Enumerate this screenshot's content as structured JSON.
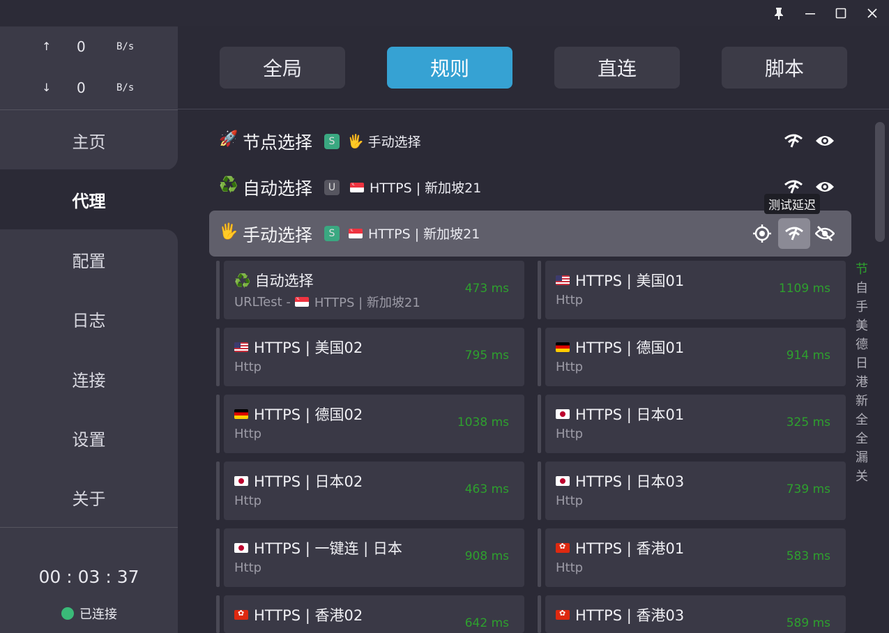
{
  "titlebar": {
    "icons": [
      "pin-icon",
      "minimize-icon",
      "maximize-icon",
      "close-icon"
    ]
  },
  "sidebar": {
    "upload": {
      "arrow": "↑",
      "value": "0",
      "unit": "B/s"
    },
    "download": {
      "arrow": "↓",
      "value": "0",
      "unit": "B/s"
    },
    "items": [
      {
        "label": "主页",
        "key": "home"
      },
      {
        "label": "代理",
        "key": "proxy"
      },
      {
        "label": "配置",
        "key": "profiles"
      },
      {
        "label": "日志",
        "key": "logs"
      },
      {
        "label": "连接",
        "key": "connections"
      },
      {
        "label": "设置",
        "key": "settings"
      },
      {
        "label": "关于",
        "key": "about"
      }
    ],
    "active_item": "代理",
    "timer": "00 : 03 : 37",
    "status": "已连接",
    "status_color": "#3aba78"
  },
  "modes": {
    "items": [
      "全局",
      "规则",
      "直连",
      "脚本"
    ],
    "active": "规则",
    "accent": "#36a2d3"
  },
  "groups": [
    {
      "emoji": "🚀",
      "name": "节点选择",
      "badge": "S",
      "current_emoji": "🖐",
      "current": "手动选择"
    },
    {
      "emoji": "♻️",
      "name": "自动选择",
      "badge": "U",
      "current_flag": "sg",
      "current": "HTTPS | 新加坡21"
    },
    {
      "emoji": "🖐",
      "name": "手动选择",
      "badge": "S",
      "current_flag": "sg",
      "current": "HTTPS | 新加坡21"
    }
  ],
  "tooltip": "测试延迟",
  "proxies": [
    {
      "name": "自动选择",
      "emoji": "♻️",
      "type": "URLTest - ",
      "type_flag": "sg",
      "type_extra": "HTTPS | 新加坡21",
      "delay": "473 ms"
    },
    {
      "name": "HTTPS | 美国01",
      "flag": "us",
      "type": "Http",
      "delay": "1109 ms"
    },
    {
      "name": "HTTPS | 美国02",
      "flag": "us",
      "type": "Http",
      "delay": "795 ms"
    },
    {
      "name": "HTTPS | 德国01",
      "flag": "de",
      "type": "Http",
      "delay": "914 ms"
    },
    {
      "name": "HTTPS | 德国02",
      "flag": "de",
      "type": "Http",
      "delay": "1038 ms"
    },
    {
      "name": "HTTPS | 日本01",
      "flag": "jp",
      "type": "Http",
      "delay": "325 ms"
    },
    {
      "name": "HTTPS | 日本02",
      "flag": "jp",
      "type": "Http",
      "delay": "463 ms"
    },
    {
      "name": "HTTPS | 日本03",
      "flag": "jp",
      "type": "Http",
      "delay": "739 ms"
    },
    {
      "name": "HTTPS | 一键连 | 日本",
      "flag": "jp",
      "type": "Http",
      "delay": "908 ms"
    },
    {
      "name": "HTTPS | 香港01",
      "flag": "hk",
      "type": "Http",
      "delay": "583 ms"
    },
    {
      "name": "HTTPS | 香港02",
      "flag": "hk",
      "type": "",
      "delay": "642 ms"
    },
    {
      "name": "HTTPS | 香港03",
      "flag": "hk",
      "type": "",
      "delay": "589 ms"
    }
  ],
  "delay_color": "#2ea02e",
  "index_letters": [
    "节",
    "自",
    "手",
    "美",
    "德",
    "日",
    "港",
    "新",
    "全",
    "全",
    "漏",
    "关"
  ],
  "index_active": "节"
}
